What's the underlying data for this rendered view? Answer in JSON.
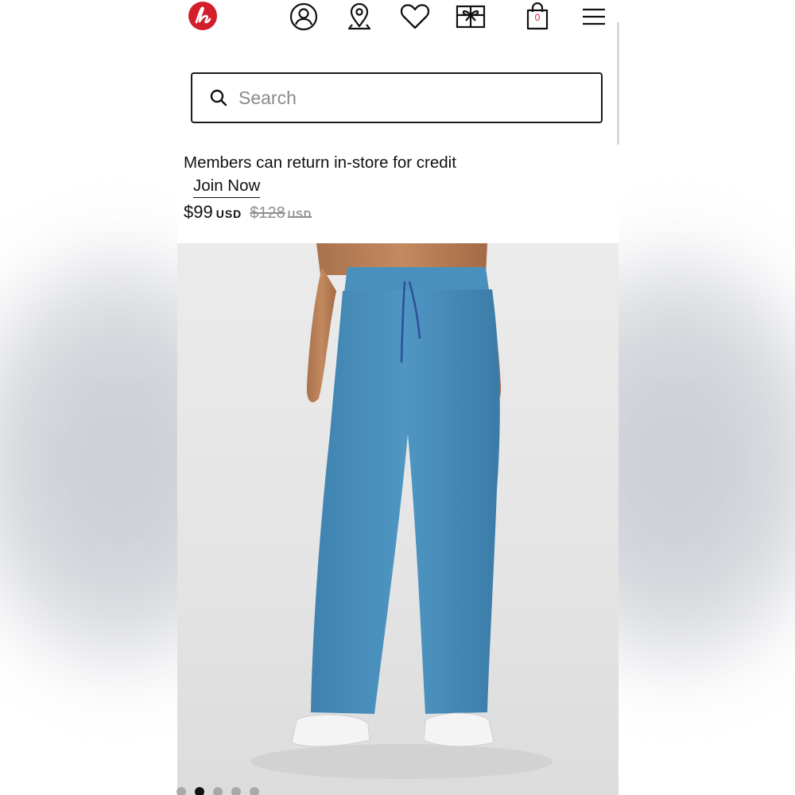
{
  "header": {
    "icons": [
      "lululemon-logo-icon",
      "account-icon",
      "store-locator-icon",
      "wishlist-heart-icon",
      "gift-card-icon",
      "shopping-bag-icon",
      "menu-icon"
    ],
    "bag_count": "0",
    "brand_color": "#d31f2b"
  },
  "search": {
    "placeholder": "Search"
  },
  "promo": {
    "text": "Members can return in-store for credit",
    "cta": "Join Now"
  },
  "price": {
    "current": "$99",
    "currency": "USD",
    "original": "$128",
    "original_currency": "USD"
  },
  "product": {
    "pant_color": "#4a90bd",
    "background_color": "#e6e6e6"
  },
  "carousel": {
    "total_dots": 5,
    "active_index": 1
  }
}
